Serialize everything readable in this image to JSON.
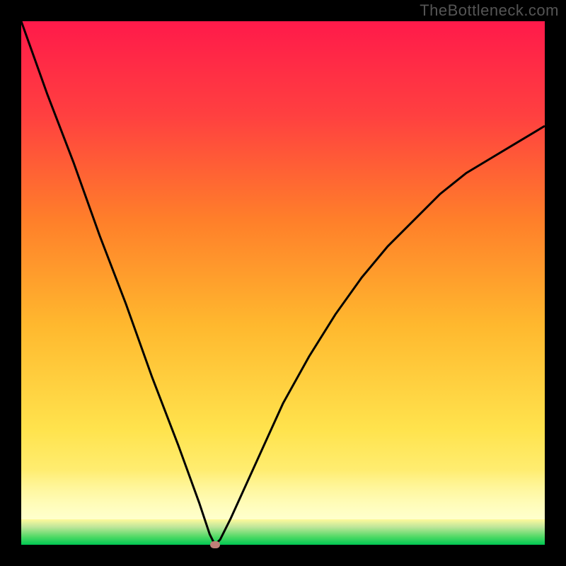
{
  "watermark": "TheBottleneck.com",
  "colors": {
    "gradient_top": "#ff1744",
    "gradient_mid1": "#ff5e3a",
    "gradient_mid2": "#ffa726",
    "gradient_mid3": "#ffd740",
    "gradient_bottom": "#ffff8d",
    "green_band": "#00c853",
    "curve": "#000000",
    "marker": "#c08078",
    "frame": "#000000"
  },
  "chart_data": {
    "type": "line",
    "title": "",
    "xlabel": "",
    "ylabel": "",
    "xrange": [
      0,
      100
    ],
    "yrange": [
      0,
      100
    ],
    "minimum_x": 37,
    "series": [
      {
        "name": "bottleneck-curve",
        "x": [
          0,
          5,
          10,
          15,
          20,
          25,
          30,
          34,
          36,
          37,
          38,
          40,
          45,
          50,
          55,
          60,
          65,
          70,
          75,
          80,
          85,
          90,
          95,
          100
        ],
        "y": [
          100,
          86,
          73,
          59,
          46,
          32,
          19,
          8,
          2,
          0,
          1,
          5,
          16,
          27,
          36,
          44,
          51,
          57,
          62,
          67,
          71,
          74,
          77,
          80
        ]
      }
    ],
    "marker": {
      "x": 37,
      "y": 0
    }
  }
}
